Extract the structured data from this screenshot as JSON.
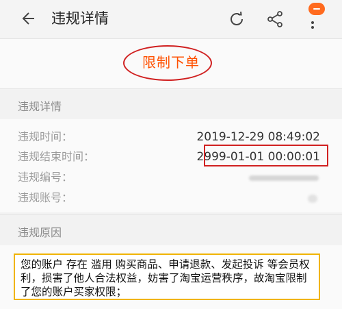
{
  "header": {
    "title": "违规详情",
    "icons": [
      "back-arrow-icon",
      "refresh-icon",
      "share-icon",
      "more-vertical-icon"
    ]
  },
  "status": {
    "label": "限制下单",
    "color": "#ff5000"
  },
  "details_section": {
    "heading": "违规详情",
    "rows": [
      {
        "label": "违规时间：",
        "value": "2019-12-29 08:49:02"
      },
      {
        "label": "违规结束时间：",
        "value": "2999-01-01 00:00:01"
      },
      {
        "label": "违规编号：",
        "value": ""
      },
      {
        "label": "违规账号：",
        "value": ""
      }
    ]
  },
  "reason_section": {
    "heading": "违规原因",
    "text": "您的账户 存在 滥用 购买商品、申请退款、发起投诉 等会员权利，损害了他人合法权益，妨害了淘宝运营秩序，故淘宝限制了您的账户买家权限；"
  },
  "colors": {
    "accent": "#ff5000",
    "annotation_red": "#d02020",
    "annotation_yellow": "#f0b400",
    "badge": "#ff6a1e"
  }
}
